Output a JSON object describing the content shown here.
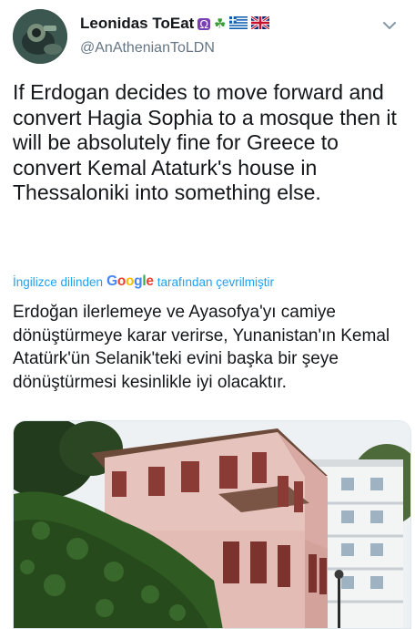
{
  "author": {
    "display_name": "Leonidas ToEat",
    "badges": [
      "Ω",
      "☘",
      "🇬🇷",
      "🇬🇧"
    ],
    "handle": "@AnAthenianToLDN"
  },
  "tweet": {
    "text": "If Erdogan decides to move forward and convert Hagia Sophia to a mosque then it will be absolutely fine for Greece to convert Kemal Ataturk's house in Thessaloniki into something else."
  },
  "translation": {
    "prefix": "İngilizce dilinden",
    "brand": "Google",
    "suffix": "tarafından çevrilmiştir",
    "text": "Erdoğan ilerlemeye ve Ayasofya'yı camiye dönüştürmeye karar verirse, Yunanistan'ın Kemal Atatürk'ün Selanik'teki evini başka bir şeye dönüştürmesi kesinlikle iyi olacaktır."
  },
  "colors": {
    "link": "#1da1f2",
    "secondary": "#657786",
    "house_wall": "#e8c8c2",
    "shutters": "#8a3b35",
    "ivy": "#2f5a22"
  },
  "icons": {
    "menu": "chevron-down-icon"
  }
}
